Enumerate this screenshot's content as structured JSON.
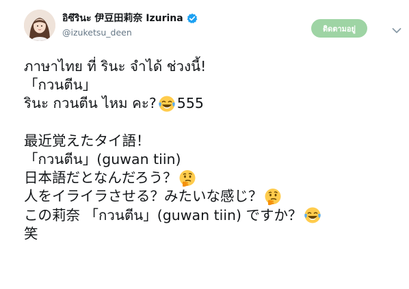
{
  "header": {
    "display_name": "อิซึรินะ 伊豆田莉奈 Izurina",
    "handle": "@izuketsu_deen",
    "follow_label": "ติดตามอยู่"
  },
  "tweet_lines": {
    "l1": "ภาษาไทย ที่ รินะ จำได้ ช่วงนี้!",
    "l2": "「กวนตีน」",
    "l3a": "รินะ กวนตีน ไหม คะ?",
    "l3b": "555",
    "l5": "最近覚えたタイ語！",
    "l6": "「กวนตีน」(guwan tiin)",
    "l7": "日本語だとなんだろう？",
    "l8": "人をイライラさせる？みたいな感じ？",
    "l9": "この莉奈 「กวนตีน」(guwan tiin)  ですか？",
    "l10": "笑"
  },
  "emoji": {
    "laugh": "face-with-tears-of-joy",
    "think": "thinking-face"
  },
  "colors": {
    "text": "#14171a",
    "handle": "#657786",
    "follow_bg": "#9ed4a4",
    "verified": "#1da1f2"
  }
}
